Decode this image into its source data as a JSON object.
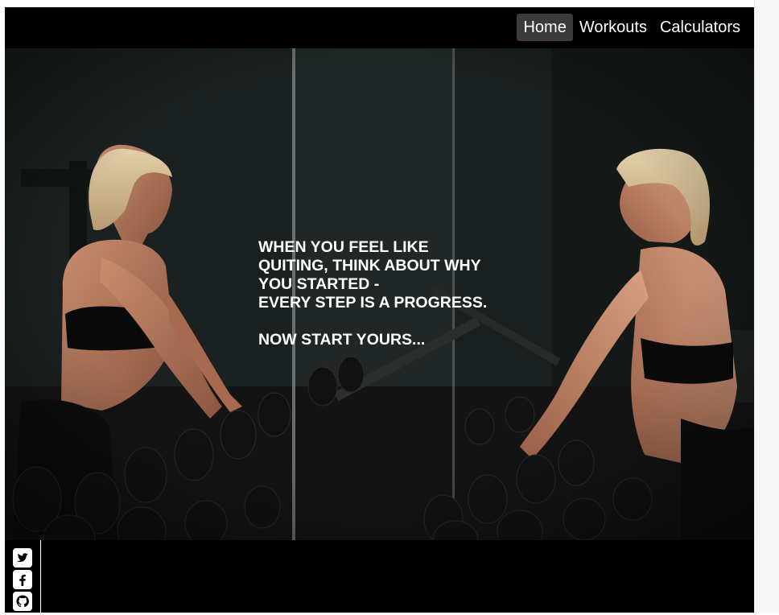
{
  "nav": {
    "links": [
      {
        "label": "Home",
        "active": true
      },
      {
        "label": "Workouts",
        "active": false
      },
      {
        "label": "Calculators",
        "active": false
      }
    ]
  },
  "hero": {
    "lines": [
      "WHEN YOU FEEL LIKE",
      "QUITING, THINK ABOUT WHY",
      "YOU STARTED -",
      "EVERY STEP IS A PROGRESS."
    ],
    "cta": "NOW START YOURS..."
  },
  "footer": {
    "social": [
      "twitter-icon",
      "facebook-icon",
      "github-icon"
    ]
  },
  "colors": {
    "navbar": "#000000",
    "active_tab": "#3b3b3b",
    "text": "#ffffff"
  }
}
